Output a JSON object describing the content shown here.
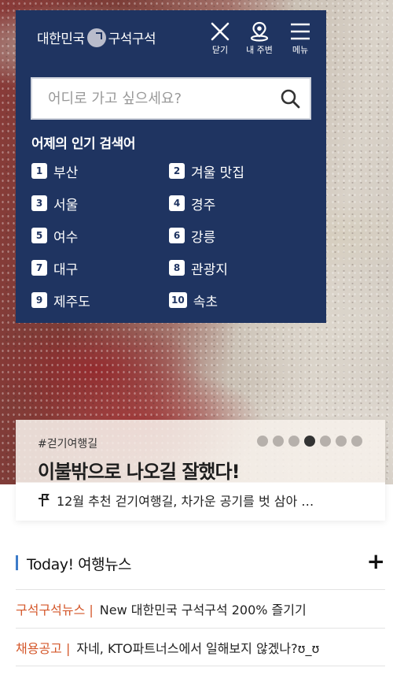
{
  "header": {
    "logo_left": "대한민국",
    "logo_right": "구석구석",
    "close_label": "닫기",
    "nearby_label": "내 주변",
    "menu_label": "메뉴"
  },
  "search": {
    "placeholder": "어디로 가고 싶으세요?"
  },
  "popular": {
    "title": "어제의 인기 검색어",
    "items": [
      {
        "rank": "1",
        "term": "부산"
      },
      {
        "rank": "2",
        "term": "겨울 맛집"
      },
      {
        "rank": "3",
        "term": "서울"
      },
      {
        "rank": "4",
        "term": "경주"
      },
      {
        "rank": "5",
        "term": "여수"
      },
      {
        "rank": "6",
        "term": "강릉"
      },
      {
        "rank": "7",
        "term": "대구"
      },
      {
        "rank": "8",
        "term": "관광지"
      },
      {
        "rank": "9",
        "term": "제주도"
      },
      {
        "rank": "10",
        "term": "속초"
      }
    ]
  },
  "story": {
    "tag": "#걷기여행길",
    "headline": "이불밖으로 나오길 잘했다!",
    "subtitle": "12월 추천 걷기여행길, 차가운 공기를 벗 삼아 …",
    "slide_count": 7,
    "active_slide": 4
  },
  "news": {
    "title": "Today! 여행뉴스",
    "more_label": "+",
    "items": [
      {
        "category": "구석구석뉴스 |",
        "text": "New 대한민국 구석구석 200% 즐기기"
      },
      {
        "category": "채용공고 |",
        "text": "자네, KTO파트너스에서 일해보지 않겠나?ʊ_ʊ"
      }
    ]
  },
  "colors": {
    "panel_bg": "#1f3461",
    "accent_category": "#d4572a",
    "news_bar": "#3d7cc9"
  }
}
